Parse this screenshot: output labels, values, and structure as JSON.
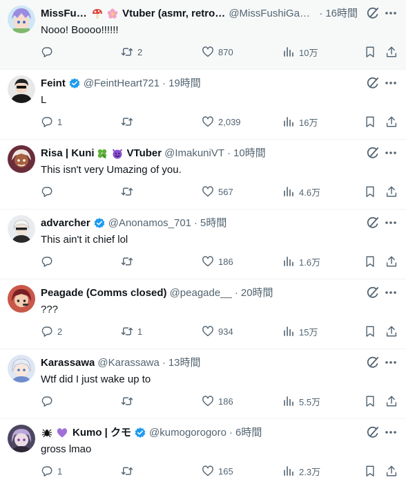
{
  "tweets": [
    {
      "name": "MissFushi",
      "emojis": [
        "mushroom-emoji",
        "cherry-blossom-emoji"
      ],
      "name_tail": "Vtuber (asmr, retro, ...",
      "handle": "@MissFushiGami...",
      "time": "16時間",
      "text": "Nooo! Boooo!!!!!!",
      "replies": "",
      "retweets": "2",
      "likes": "870",
      "views": "10万",
      "verified": false
    },
    {
      "name": "Feint",
      "handle": "@FeintHeart721",
      "time": "19時間",
      "text": "L",
      "replies": "1",
      "retweets": "",
      "likes": "2,039",
      "views": "16万",
      "verified": true
    },
    {
      "name": "Risa | Kuni",
      "emojis": [
        "four-leaf-clover-emoji",
        "smiling-imp-emoji"
      ],
      "name_tail": "VTuber",
      "handle": "@ImakuniVT",
      "time": "10時間",
      "text": "This isn't very Umazing of you.",
      "replies": "",
      "retweets": "",
      "likes": "567",
      "views": "4.6万",
      "verified": false
    },
    {
      "name": "advarcher",
      "handle": "@Anonamos_701",
      "time": "5時間",
      "text": "This ain't it chief lol",
      "replies": "",
      "retweets": "",
      "likes": "186",
      "views": "1.6万",
      "verified": true
    },
    {
      "name": "Peagade (Comms closed)",
      "handle": "@peagade__",
      "time": "20時間",
      "text": "???",
      "replies": "2",
      "retweets": "1",
      "likes": "934",
      "views": "15万",
      "verified": false
    },
    {
      "name": "Karassawa",
      "handle": "@Karassawa",
      "time": "13時間",
      "text": "Wtf did I just wake up to",
      "replies": "",
      "retweets": "",
      "likes": "186",
      "views": "5.5万",
      "verified": false
    },
    {
      "name": "Kumo | クモ",
      "emojis_before": [
        "spider-emoji",
        "purple-heart-emoji"
      ],
      "handle": "@kumogorogoro",
      "time": "6時間",
      "text": "gross lmao",
      "replies": "1",
      "retweets": "",
      "likes": "165",
      "views": "2.3万",
      "verified": true
    }
  ],
  "separator": "·",
  "colors": {
    "text_primary": "#0f1419",
    "text_secondary": "#536471",
    "verified_blue": "#1d9bf0",
    "divider": "#eff3f4",
    "highlight_bg": "#f7f9f9"
  }
}
